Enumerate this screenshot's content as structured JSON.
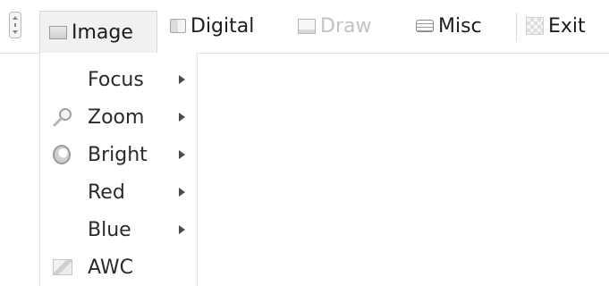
{
  "menubar": {
    "items": [
      {
        "label": "Image",
        "icon": "image-icon",
        "state": "active"
      },
      {
        "label": "Digital",
        "icon": "digital-icon",
        "state": "normal"
      },
      {
        "label": "Draw",
        "icon": "draw-icon",
        "state": "disabled"
      },
      {
        "label": "Misc",
        "icon": "misc-icon",
        "state": "normal"
      },
      {
        "label": "Exit",
        "icon": "exit-icon",
        "state": "normal"
      }
    ]
  },
  "image_menu": {
    "items": [
      {
        "label": "Focus",
        "icon": null,
        "submenu": true
      },
      {
        "label": "Zoom",
        "icon": "magnifier-icon",
        "submenu": true
      },
      {
        "label": "Bright",
        "icon": "brightness-icon",
        "submenu": true
      },
      {
        "label": "Red",
        "icon": null,
        "submenu": true
      },
      {
        "label": "Blue",
        "icon": null,
        "submenu": true
      },
      {
        "label": "AWC",
        "icon": "awc-icon",
        "submenu": false
      }
    ]
  },
  "colors": {
    "text": "#1c1c1c",
    "disabled_text": "#c2c2c2",
    "active_bg": "#f1f1f1",
    "border": "#d6d6d6"
  }
}
